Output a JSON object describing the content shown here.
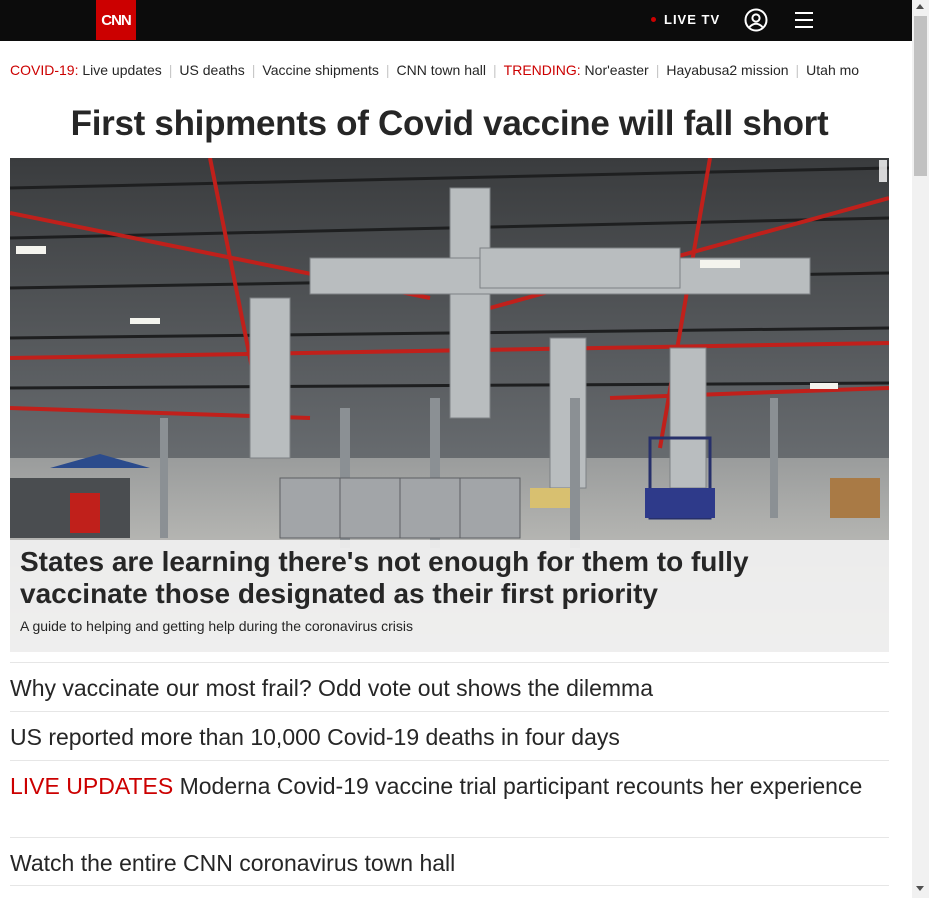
{
  "header": {
    "logo_text": "CNN",
    "live_tv": "LIVE TV",
    "user_icon": "user-icon",
    "menu_icon": "hamburger-menu-icon",
    "brand_color": "#cc0000"
  },
  "trending": {
    "covid_label": "COVID-19:",
    "covid_items": [
      "Live updates",
      "US deaths",
      "Vaccine shipments",
      "CNN town hall"
    ],
    "trending_label": "TRENDING:",
    "trending_items": [
      "Nor'easter",
      "Hayabusa2 mission",
      "Utah mo"
    ]
  },
  "main": {
    "headline": "First shipments of Covid vaccine will fall short",
    "hero": {
      "title": "States are learning there's not enough for them to fully vaccinate those designated as their first priority",
      "subtitle": "A guide to helping and getting help during the coronavirus crisis"
    },
    "stories": [
      {
        "live": "",
        "text": "Why vaccinate our most frail? Odd vote out shows the dilemma"
      },
      {
        "live": "",
        "text": "US reported more than 10,000 Covid-19 deaths in four days"
      },
      {
        "live": "LIVE UPDATES",
        "text": "Moderna Covid-19 vaccine trial participant recounts her experience"
      },
      {
        "live": "",
        "text": "Watch the entire CNN coronavirus town hall"
      }
    ]
  }
}
